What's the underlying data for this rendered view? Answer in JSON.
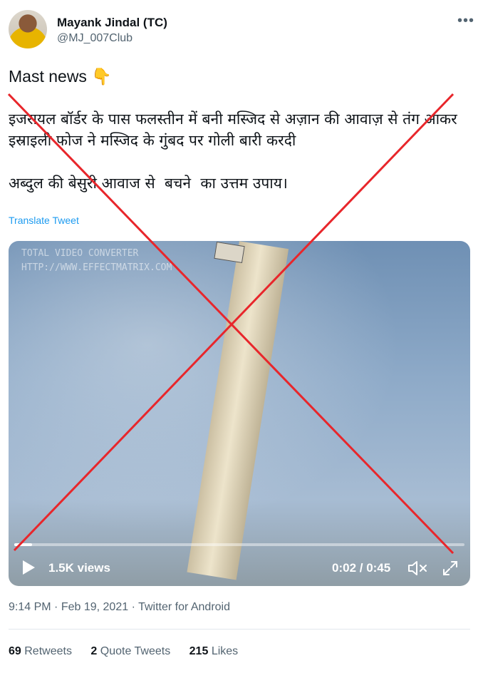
{
  "author": {
    "name": "Mayank Jindal (TC)",
    "handle": "@MJ_007Club"
  },
  "tweet": {
    "line1": "Mast news 👇",
    "line2": "इजरायल बॉर्डर के पास फलस्तीन में बनी मस्जिद से अज़ान की आवाज़ से तंग आकर इस्राइली फोज ने मस्जिद के गुंबद पर गोली बारी करदी",
    "line3": "अब्दुल की बेसुरी आवाज से  बचने  का उत्तम उपाय।",
    "translate_label": "Translate Tweet"
  },
  "media": {
    "watermark_line1": "TOTAL VIDEO CONVERTER",
    "watermark_line2": "HTTP://WWW.EFFECTMATRIX.COM",
    "views": "1.5K views",
    "time": "0:02 / 0:45",
    "progress_fraction": 0.04
  },
  "meta": {
    "time": "9:14 PM",
    "date": "Feb 19, 2021",
    "source": "Twitter for Android"
  },
  "stats": {
    "retweets_count": "69",
    "retweets_label": "Retweets",
    "quotes_count": "2",
    "quotes_label": "Quote Tweets",
    "likes_count": "215",
    "likes_label": "Likes"
  },
  "colors": {
    "link": "#1d9bf0",
    "secondary_text": "#536471",
    "cross": "#e8262b"
  },
  "icons": [
    "more-icon",
    "play-icon",
    "mute-icon",
    "fullscreen-icon"
  ]
}
